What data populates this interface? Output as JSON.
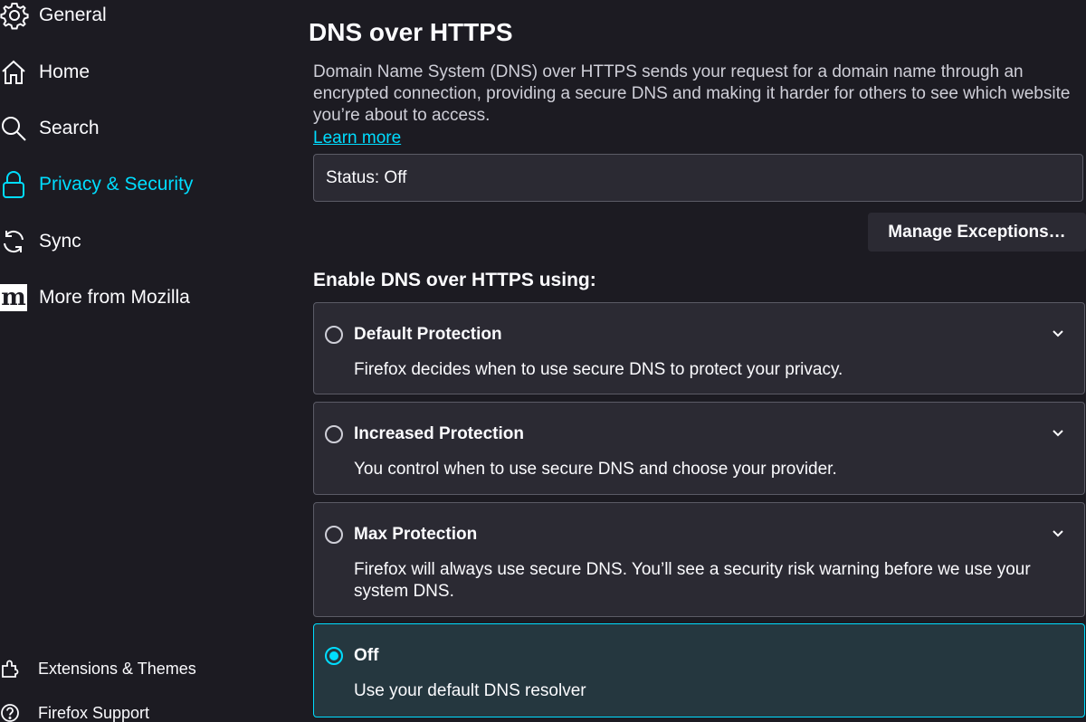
{
  "sidebar": {
    "items": [
      {
        "label": "General",
        "icon": "gear-icon"
      },
      {
        "label": "Home",
        "icon": "home-icon"
      },
      {
        "label": "Search",
        "icon": "search-icon"
      },
      {
        "label": "Privacy & Security",
        "icon": "lock-icon",
        "active": true
      },
      {
        "label": "Sync",
        "icon": "sync-icon"
      },
      {
        "label": "More from Mozilla",
        "icon": "mozilla-m-icon",
        "icon_glyph": "m"
      }
    ],
    "footer": [
      {
        "label": "Extensions & Themes",
        "icon": "puzzle-icon"
      },
      {
        "label": "Firefox Support",
        "icon": "help-icon"
      }
    ]
  },
  "main": {
    "title": "DNS over HTTPS",
    "description": "Domain Name System (DNS) over HTTPS sends your request for a domain name through an encrypted connection, providing a secure DNS and making it harder for others to see which website you’re about to access.",
    "learn_more": "Learn more",
    "status": "Status: Off",
    "manage_exceptions": "Manage Exceptions…",
    "enable_heading": "Enable DNS over HTTPS using:",
    "options": [
      {
        "title": "Default Protection",
        "description": "Firefox decides when to use secure DNS to protect your privacy.",
        "selected": false
      },
      {
        "title": "Increased Protection",
        "description": "You control when to use secure DNS and choose your provider.",
        "selected": false
      },
      {
        "title": "Max Protection",
        "description": "Firefox will always use secure DNS. You’ll see a security risk warning before we use your system DNS.",
        "selected": false
      },
      {
        "title": "Off",
        "description": "Use your default DNS resolver",
        "selected": true
      }
    ]
  },
  "colors": {
    "background": "#1c1b22",
    "panel": "#2b2a33",
    "accent": "#00ddff",
    "selected_panel": "#25373f"
  }
}
